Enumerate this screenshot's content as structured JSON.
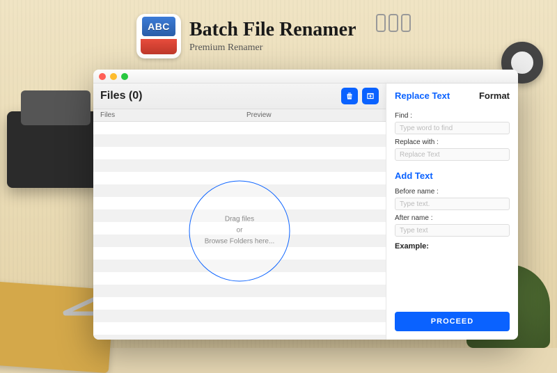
{
  "app": {
    "icon_text": "ABC",
    "title": "Batch File Renamer",
    "subtitle": "Premium Renamer"
  },
  "window": {
    "files_heading": "Files (0)",
    "columns": {
      "files": "Files",
      "preview": "Preview"
    },
    "dropzone": {
      "line1": "Drag files",
      "line2": "or",
      "line3": "Browse Folders here..."
    },
    "actions": {
      "trash_icon_name": "trash-icon",
      "browse_icon_name": "browse-icon"
    }
  },
  "panel": {
    "tabs": {
      "replace": "Replace Text",
      "format": "Format"
    },
    "replace": {
      "find_label": "Find :",
      "find_placeholder": "Type word to find",
      "replace_label": "Replace with :",
      "replace_placeholder": "Replace Text"
    },
    "add": {
      "section": "Add Text",
      "before_label": "Before name :",
      "before_placeholder": "Type text.",
      "after_label": "After name :",
      "after_placeholder": "Type text",
      "example_label": "Example:"
    },
    "proceed": "PROCEED"
  },
  "colors": {
    "accent": "#0a62ff"
  }
}
